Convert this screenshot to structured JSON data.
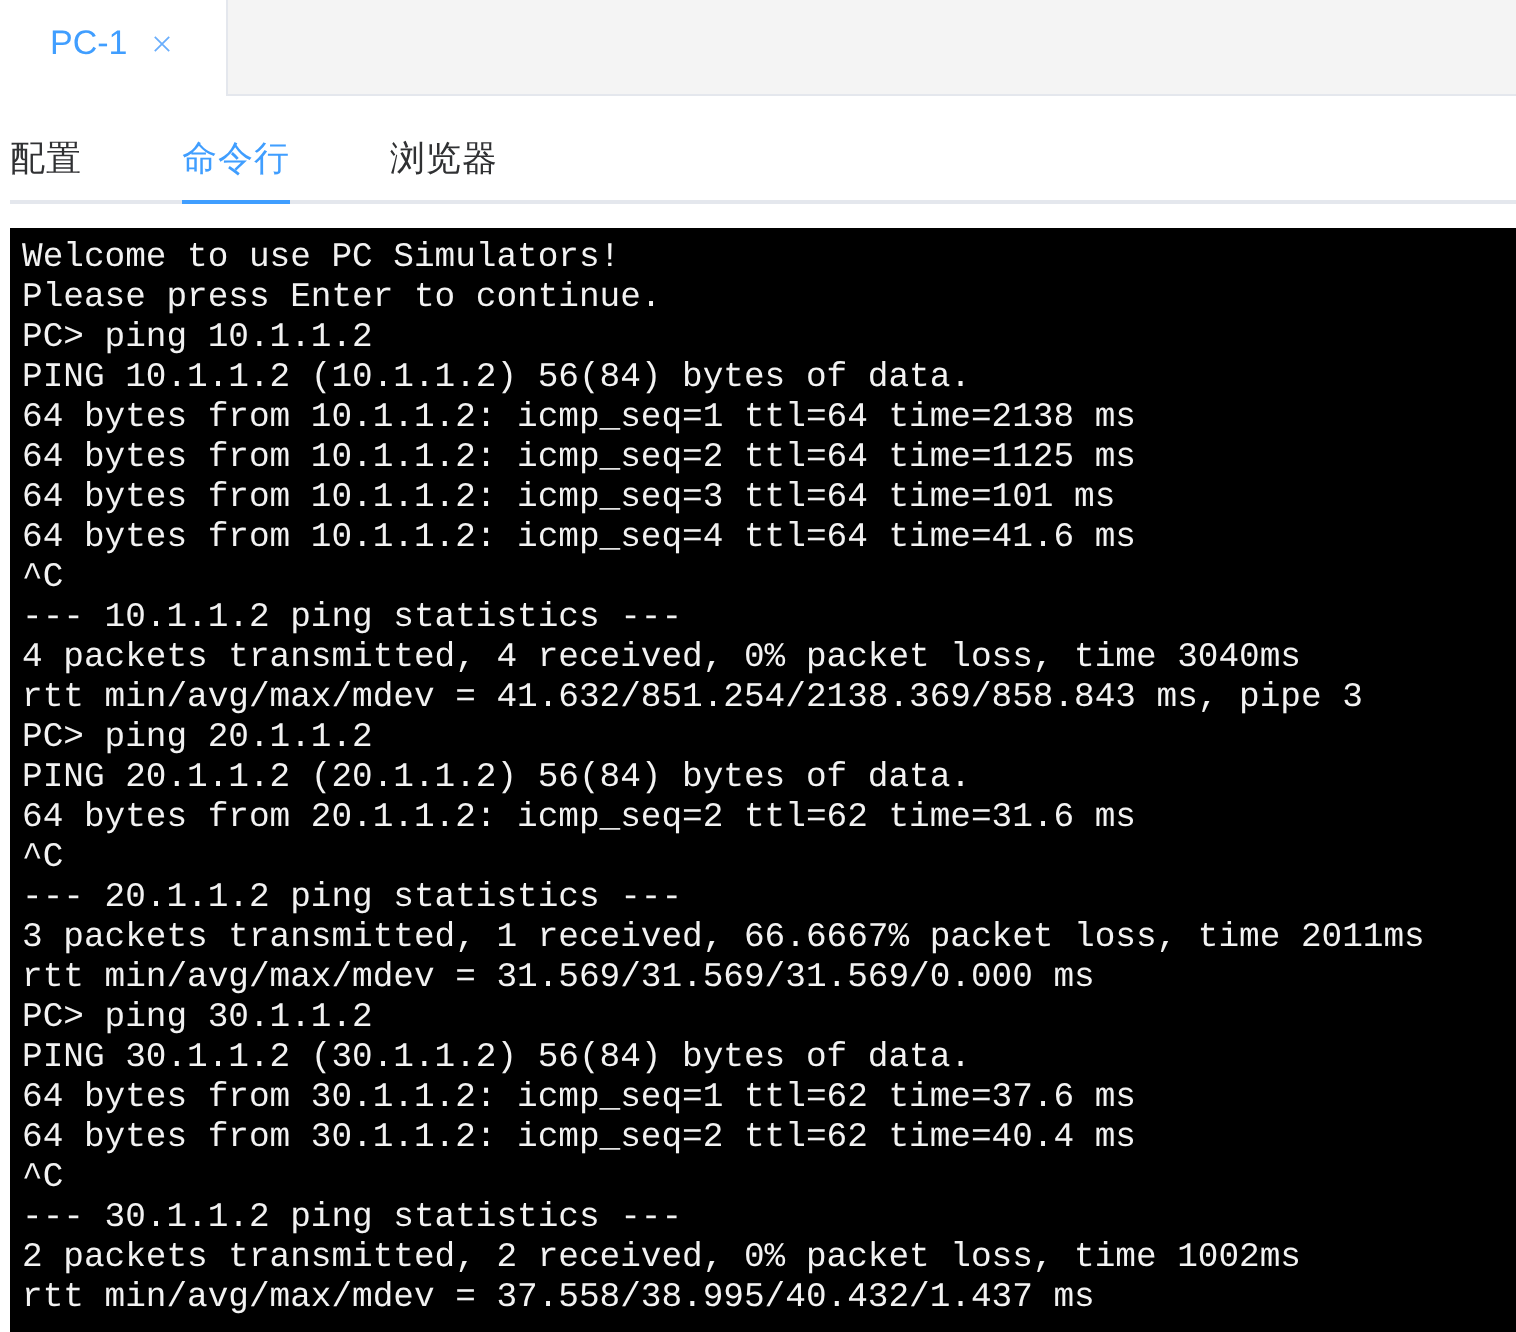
{
  "document_tabs": [
    {
      "label": "PC-1",
      "selected": true
    }
  ],
  "view_tabs": [
    {
      "label": "配置",
      "selected": false
    },
    {
      "label": "命令行",
      "selected": true
    },
    {
      "label": "浏览器",
      "selected": false
    }
  ],
  "terminal": {
    "lines": [
      "Welcome to use PC Simulators!",
      "Please press Enter to continue.",
      "PC> ping 10.1.1.2",
      "PING 10.1.1.2 (10.1.1.2) 56(84) bytes of data.",
      "64 bytes from 10.1.1.2: icmp_seq=1 ttl=64 time=2138 ms",
      "64 bytes from 10.1.1.2: icmp_seq=2 ttl=64 time=1125 ms",
      "64 bytes from 10.1.1.2: icmp_seq=3 ttl=64 time=101 ms",
      "64 bytes from 10.1.1.2: icmp_seq=4 ttl=64 time=41.6 ms",
      "^C",
      "--- 10.1.1.2 ping statistics ---",
      "4 packets transmitted, 4 received, 0% packet loss, time 3040ms",
      "rtt min/avg/max/mdev = 41.632/851.254/2138.369/858.843 ms, pipe 3",
      "PC> ping 20.1.1.2",
      "PING 20.1.1.2 (20.1.1.2) 56(84) bytes of data.",
      "64 bytes from 20.1.1.2: icmp_seq=2 ttl=62 time=31.6 ms",
      "^C",
      "--- 20.1.1.2 ping statistics ---",
      "3 packets transmitted, 1 received, 66.6667% packet loss, time 2011ms",
      "rtt min/avg/max/mdev = 31.569/31.569/31.569/0.000 ms",
      "PC> ping 30.1.1.2",
      "PING 30.1.1.2 (30.1.1.2) 56(84) bytes of data.",
      "64 bytes from 30.1.1.2: icmp_seq=1 ttl=62 time=37.6 ms",
      "64 bytes from 30.1.1.2: icmp_seq=2 ttl=62 time=40.4 ms",
      "^C",
      "--- 30.1.1.2 ping statistics ---",
      "2 packets transmitted, 2 received, 0% packet loss, time 1002ms",
      "rtt min/avg/max/mdev = 37.558/38.995/40.432/1.437 ms"
    ]
  }
}
